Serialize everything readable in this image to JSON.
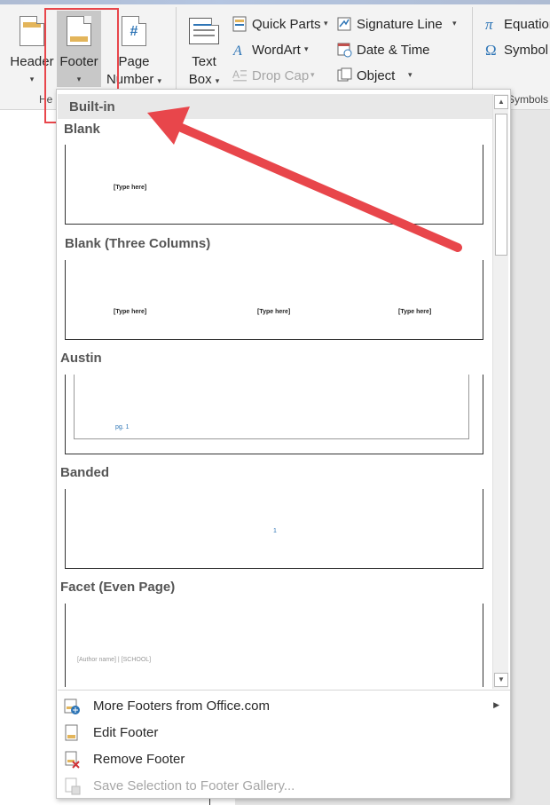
{
  "ribbon": {
    "header": {
      "line1": "Header",
      "caret": "▾"
    },
    "footer": {
      "line1": "Footer",
      "caret": "▾"
    },
    "page_number": {
      "line1": "Page",
      "line2": "Number",
      "caret": "▾"
    },
    "text_box": {
      "line1": "Text",
      "line2": "Box",
      "caret": "▾"
    },
    "quick_parts": {
      "label": "Quick Parts",
      "caret": "▾"
    },
    "wordart": {
      "label": "WordArt",
      "caret": "▾"
    },
    "drop_cap": {
      "label": "Drop Cap",
      "caret": "▾"
    },
    "signature_line": {
      "label": "Signature Line",
      "caret": "▾"
    },
    "date_time": {
      "label": "Date & Time"
    },
    "object": {
      "label": "Object",
      "caret": "▾"
    },
    "equation": {
      "label": "Equation"
    },
    "symbol": {
      "label": "Symbol"
    },
    "group_header_footer_partial": "He",
    "group_symbols_partial": "Symbols"
  },
  "dropdown": {
    "section_header": "Built-in",
    "gallery": [
      {
        "title": "Blank",
        "placeholders": [
          "[Type here]"
        ]
      },
      {
        "title": "Blank (Three Columns)",
        "placeholders": [
          "[Type here]",
          "[Type here]",
          "[Type here]"
        ]
      },
      {
        "title": "Austin",
        "page_label": "pg. 1"
      },
      {
        "title": "Banded",
        "page_label": "1"
      },
      {
        "title": "Facet (Even Page)",
        "author_text": "[Author name] | [SCHOOL]"
      }
    ],
    "menu": [
      {
        "label": "More Footers from Office.com",
        "has_submenu": true,
        "submenu_arrow": "▶"
      },
      {
        "label": "Edit Footer"
      },
      {
        "label": "Remove Footer"
      },
      {
        "label": "Save Selection to Footer Gallery...",
        "disabled": true
      }
    ],
    "scroll_up": "▲",
    "scroll_down": "▼"
  },
  "colors": {
    "highlight_box": "#e8464b",
    "arrow": "#e8464b",
    "footer_band": "#e3b55b",
    "accent_blue": "#2e75b6"
  }
}
